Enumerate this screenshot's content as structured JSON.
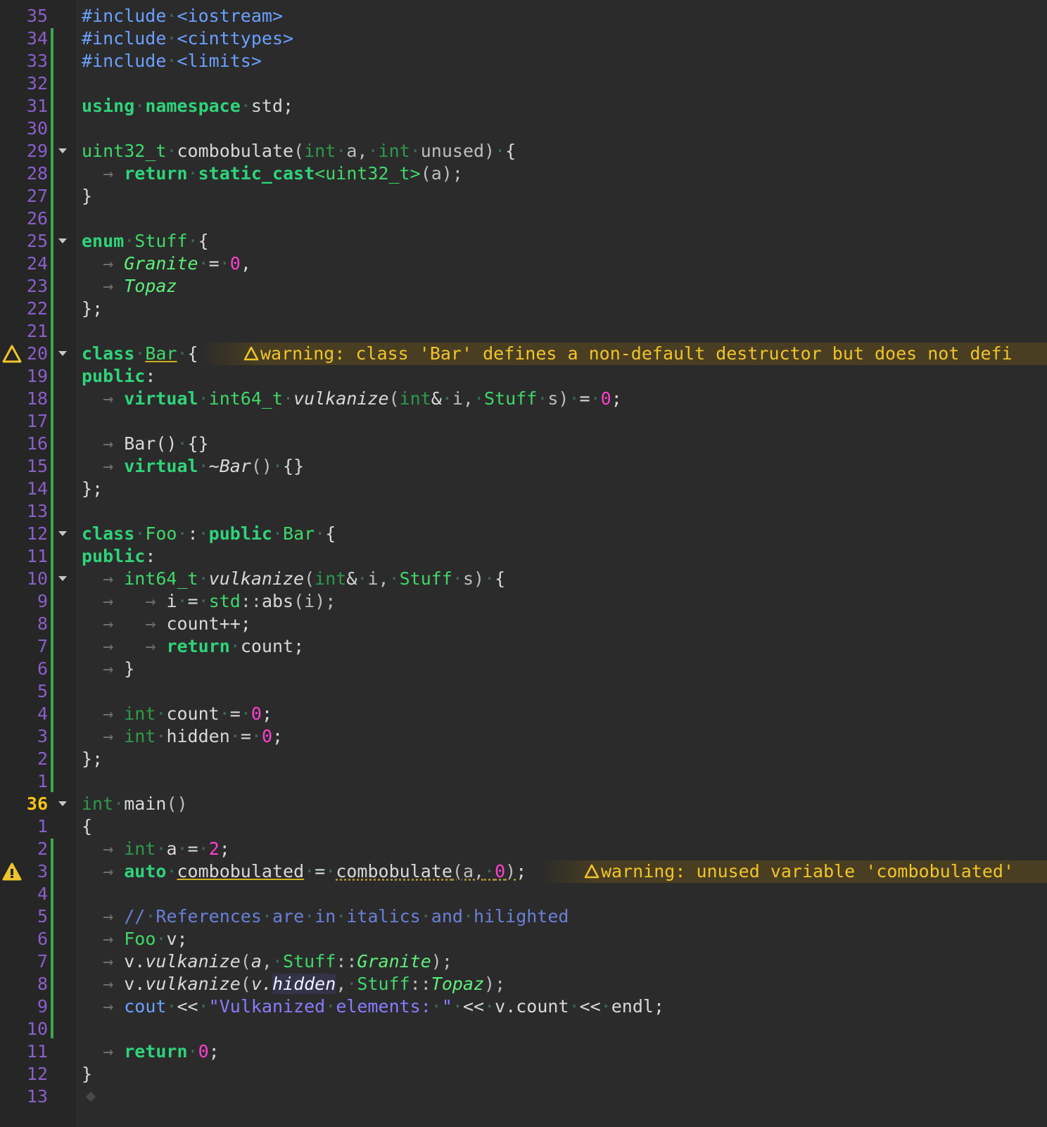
{
  "editor": {
    "language": "C++",
    "current_line_number": "36",
    "lines": [
      {
        "ln": "35",
        "text": "#include <iostream>"
      },
      {
        "ln": "34",
        "text": "#include <cinttypes>"
      },
      {
        "ln": "33",
        "text": "#include <limits>"
      },
      {
        "ln": "32",
        "text": ""
      },
      {
        "ln": "31",
        "text": "using namespace std;"
      },
      {
        "ln": "30",
        "text": ""
      },
      {
        "ln": "29",
        "text": "uint32_t combobulate(int a, int unused) {"
      },
      {
        "ln": "28",
        "text": "return static_cast<uint32_t>(a);"
      },
      {
        "ln": "27",
        "text": "}"
      },
      {
        "ln": "26",
        "text": ""
      },
      {
        "ln": "25",
        "text": "enum Stuff {"
      },
      {
        "ln": "24",
        "text": "Granite = 0,"
      },
      {
        "ln": "23",
        "text": "Topaz"
      },
      {
        "ln": "22",
        "text": "};"
      },
      {
        "ln": "21",
        "text": ""
      },
      {
        "ln": "20",
        "text": "class Bar {"
      },
      {
        "ln": "19",
        "text": "public:"
      },
      {
        "ln": "18",
        "text": "virtual int64_t vulkanize(int& i, Stuff s) = 0;"
      },
      {
        "ln": "17",
        "text": ""
      },
      {
        "ln": "16",
        "text": "Bar() {}"
      },
      {
        "ln": "15",
        "text": "virtual ~Bar() {}"
      },
      {
        "ln": "14",
        "text": "};"
      },
      {
        "ln": "13",
        "text": ""
      },
      {
        "ln": "12",
        "text": "class Foo : public Bar {"
      },
      {
        "ln": "11",
        "text": "public:"
      },
      {
        "ln": "10",
        "text": "int64_t vulkanize(int& i, Stuff s) {"
      },
      {
        "ln": "9",
        "text": "i = std::abs(i);"
      },
      {
        "ln": "8",
        "text": "count++;"
      },
      {
        "ln": "7",
        "text": "return count;"
      },
      {
        "ln": "6",
        "text": "}"
      },
      {
        "ln": "5",
        "text": ""
      },
      {
        "ln": "4",
        "text": "int count = 0;"
      },
      {
        "ln": "3",
        "text": "int hidden = 0;"
      },
      {
        "ln": "2",
        "text": "};"
      },
      {
        "ln": "1",
        "text": ""
      },
      {
        "ln": "36",
        "text": "int main()"
      },
      {
        "ln": "1",
        "text": "{"
      },
      {
        "ln": "2",
        "text": "int a = 2;"
      },
      {
        "ln": "3",
        "text": "auto combobulated = combobulate(a, 0);"
      },
      {
        "ln": "4",
        "text": ""
      },
      {
        "ln": "5",
        "text": "// References are in italics and hilighted"
      },
      {
        "ln": "6",
        "text": "Foo v;"
      },
      {
        "ln": "7",
        "text": "v.vulkanize(a, Stuff::Granite);"
      },
      {
        "ln": "8",
        "text": "v.vulkanize(v.hidden, Stuff::Topaz);"
      },
      {
        "ln": "9",
        "text": "cout << \"Vulkanized elements: \" << v.count << endl;"
      },
      {
        "ln": "10",
        "text": ""
      },
      {
        "ln": "11",
        "text": "return 0;"
      },
      {
        "ln": "12",
        "text": "}"
      },
      {
        "ln": "13",
        "text": ""
      }
    ],
    "warnings": [
      {
        "line": "20",
        "message": "warning: class 'Bar' defines a non-default destructor but does not defi"
      },
      {
        "line": "3",
        "message": "warning: unused variable 'combobulated'"
      }
    ],
    "colors": {
      "background": "#2b2b2b",
      "gutter_background": "#262626",
      "line_number": "#8a5fc8",
      "current_line_number": "#f5c518",
      "keyword": "#2ed47a",
      "type": "#3fd86a",
      "number": "#ff3fd2",
      "string": "#8a7cff",
      "comment": "#6a80d8",
      "preprocessor": "#6ba0ff",
      "warning": "#f0c528",
      "git_added": "#3aa84a"
    }
  }
}
